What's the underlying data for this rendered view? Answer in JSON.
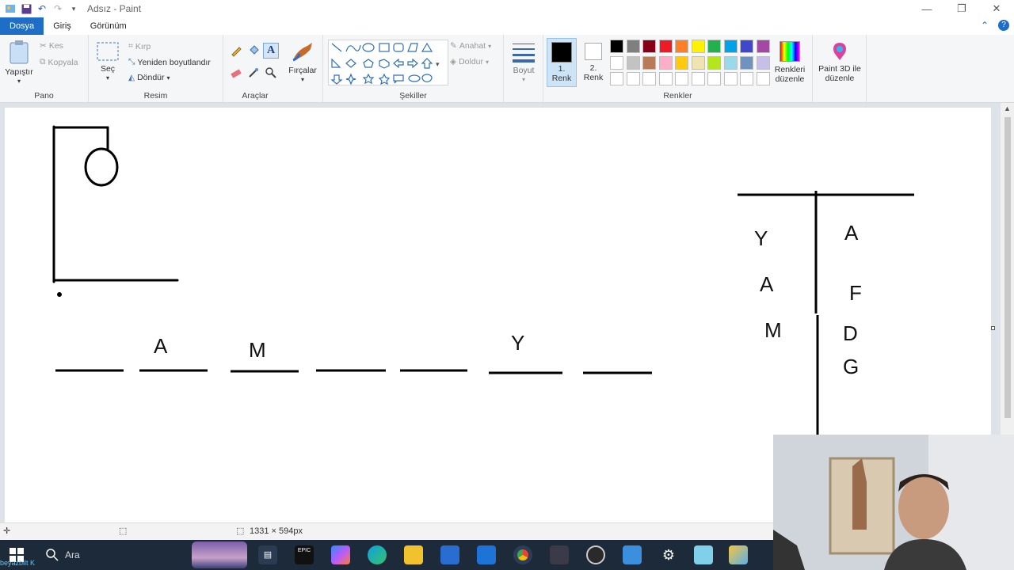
{
  "window": {
    "title": "Adsız - Paint"
  },
  "tabs": {
    "file": "Dosya",
    "home": "Giriş",
    "view": "Görünüm"
  },
  "clipboard": {
    "paste": "Yapıştır",
    "cut": "Kes",
    "copy": "Kopyala",
    "label": "Pano"
  },
  "image": {
    "select": "Seç",
    "crop": "Kırp",
    "resize": "Yeniden boyutlandır",
    "rotate": "Döndür",
    "label": "Resim"
  },
  "tools": {
    "label": "Araçlar",
    "brushes": "Fırçalar"
  },
  "shapes": {
    "outline": "Anahat",
    "fill": "Doldur",
    "label": "Şekiller"
  },
  "size": {
    "label": "Boyut"
  },
  "colors": {
    "color1_line1": "1.",
    "color1_line2": "Renk",
    "color2_line1": "2.",
    "color2_line2": "Renk",
    "edit_line1": "Renkleri",
    "edit_line2": "düzenle",
    "label": "Renkler",
    "palette_row1": [
      "#000000",
      "#7f7f7f",
      "#880015",
      "#ed1c24",
      "#ff7f27",
      "#fff200",
      "#22b14c",
      "#00a2e8",
      "#3f48cc",
      "#a349a4"
    ],
    "palette_row2": [
      "#ffffff",
      "#c3c3c3",
      "#b97a57",
      "#ffaec9",
      "#ffc90e",
      "#efe4b0",
      "#b5e61d",
      "#99d9ea",
      "#7092be",
      "#c8bfe7"
    ]
  },
  "paint3d": {
    "line1": "Paint 3D ile",
    "line2": "düzenle"
  },
  "canvas": {
    "word_letters": [
      "A",
      "M",
      "Y"
    ],
    "left_column": [
      "Y",
      "A",
      "M"
    ],
    "right_column": [
      "A",
      "F",
      "D",
      "G"
    ]
  },
  "status": {
    "dimensions": "1331 × 594px"
  },
  "taskbar": {
    "search": "Ara",
    "tray_text": "beyazbilt K"
  }
}
